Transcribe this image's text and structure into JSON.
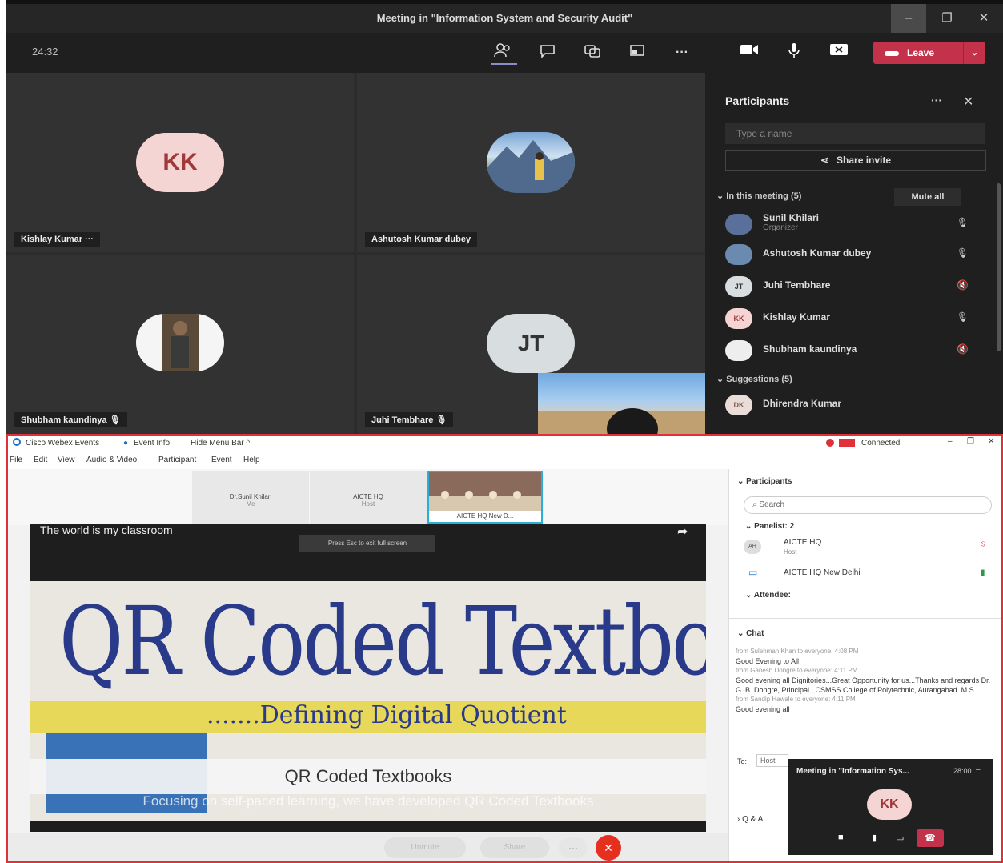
{
  "teams": {
    "title": "Meeting in \"Information System and Security Audit\"",
    "window_controls": [
      "–",
      "❐",
      "✕"
    ],
    "timer": "24:32",
    "toolbar_icons": [
      "participants-icon",
      "chat-icon",
      "reactions-icon",
      "share-tray-icon",
      "more-icon",
      "camera-icon",
      "mic-icon",
      "share-screen-icon"
    ],
    "leave_label": "Leave",
    "tiles": [
      {
        "name": "Kishlay Kumar",
        "initials": "KK",
        "extra": "···"
      },
      {
        "name": "Ashutosh Kumar dubey",
        "initials": ""
      },
      {
        "name": "Shubham kaundinya",
        "initials": ""
      },
      {
        "name": "Juhi Tembhare",
        "initials": "JT"
      }
    ],
    "panel": {
      "title": "Participants",
      "search_placeholder": "Type a name",
      "share_invite": "Share invite",
      "in_meeting": "In this meeting (5)",
      "mute_all": "Mute all",
      "participants": [
        {
          "name": "Sunil Khilari",
          "role": "Organizer",
          "initials": ""
        },
        {
          "name": "Ashutosh Kumar dubey",
          "role": "",
          "initials": ""
        },
        {
          "name": "Juhi Tembhare",
          "role": "",
          "initials": "JT"
        },
        {
          "name": "Kishlay Kumar",
          "role": "",
          "initials": "KK"
        },
        {
          "name": "Shubham kaundinya",
          "role": "",
          "initials": ""
        }
      ],
      "suggestions": "Suggestions (5)",
      "suggestion_people": [
        {
          "name": "Dhirendra Kumar",
          "initials": "DK"
        }
      ]
    }
  },
  "webex": {
    "app_name": "Cisco Webex Events",
    "event_info": "Event Info",
    "hide_menu": "Hide Menu Bar ^",
    "connected": "Connected",
    "menu": [
      "File",
      "Edit",
      "View",
      "Audio & Video",
      "Participant",
      "Event",
      "Help"
    ],
    "thumbs": [
      {
        "name": "Dr.Sunil Khilari",
        "sub": "Me"
      },
      {
        "name": "AICTE HQ",
        "sub": "Host"
      },
      {
        "name": "AICTE HQ New D...",
        "sub": ""
      }
    ],
    "share_caption": "The world is my classroom",
    "press_esc": "Press Esc to exit full screen",
    "slide_line1": "QR Coded Textbook",
    "slide_line2": ".......Defining Digital Quotient",
    "overlay_title": "QR Coded Textbooks",
    "overlay_sub": "Focusing on self-paced learning, we have developed QR Coded Textbooks",
    "right_panel": {
      "participants_title": "Participants",
      "search_placeholder": "Search",
      "panelist": "Panelist: 2",
      "people": [
        {
          "name": "AICTE HQ",
          "role": "Host",
          "initials": "AH"
        },
        {
          "name": "AICTE HQ New Delhi",
          "role": "",
          "initials": ""
        }
      ],
      "attendee": "Attendee:",
      "chat_title": "Chat",
      "chat_messages": [
        {
          "from": "from Sulehman Khan to everyone: 4:08 PM",
          "text": "Good Evening to All"
        },
        {
          "from": "from Ganesh Dongre to everyone: 4:11 PM",
          "text": "Good evening all Dignitories...Great Opportunity for us...Thanks and regards Dr. G. B. Dongre, Principal , CSMSS College of Polytechnic, Aurangabad. M.S."
        },
        {
          "from": "from Sandip Hawale to everyone: 4:11 PM",
          "text": "Good evening all"
        }
      ],
      "to_label": "To:",
      "to_value": "Host",
      "qa": "Q & A"
    },
    "controls": [
      "Unmute",
      "Share",
      "···"
    ],
    "mini": {
      "title": "Meeting in \"Information Sys...",
      "time": "28:00",
      "initials": "KK"
    }
  },
  "colors": {
    "teams_bg": "#292929",
    "leave": "#c4314b",
    "avatar_pink": "#f5d5d3",
    "webex_border": "#e0303a",
    "end_red": "#e5301f"
  }
}
